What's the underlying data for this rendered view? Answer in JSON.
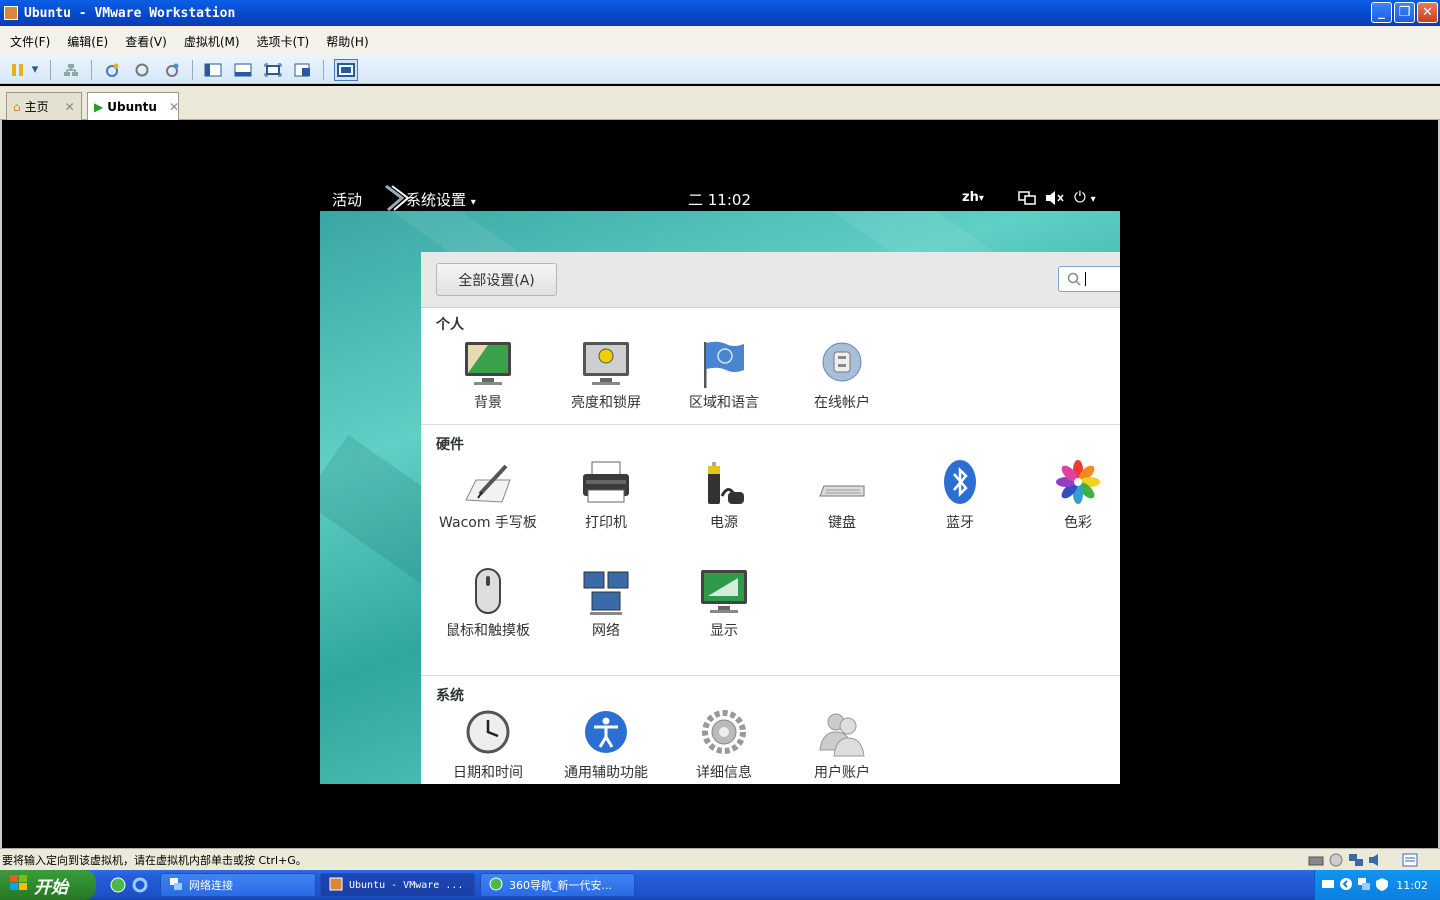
{
  "window": {
    "title": "Ubuntu - VMware Workstation",
    "min": "_",
    "max": "❐",
    "close": "✕"
  },
  "menu": [
    {
      "label": "文件(F)"
    },
    {
      "label": "编辑(E)"
    },
    {
      "label": "查看(V)"
    },
    {
      "label": "虚拟机(M)"
    },
    {
      "label": "选项卡(T)"
    },
    {
      "label": "帮助(H)"
    }
  ],
  "tabs": {
    "home": "主页",
    "ubuntu": "Ubuntu",
    "close": "✕"
  },
  "gnome": {
    "activities": "活动",
    "app_menu": "系统设置",
    "clock": "二  11:02",
    "lang": "zh",
    "arrow": "▾",
    "power": "⏻"
  },
  "settings": {
    "all_button": "全部设置(A)",
    "sections": {
      "personal": {
        "title": "个人",
        "items": [
          {
            "label": "背景",
            "icon": "background-icon"
          },
          {
            "label": "亮度和锁屏",
            "icon": "brightness-lock-icon"
          },
          {
            "label": "区域和语言",
            "icon": "region-language-icon"
          },
          {
            "label": "在线帐户",
            "icon": "online-accounts-icon"
          }
        ]
      },
      "hardware": {
        "title": "硬件",
        "items": [
          {
            "label": "Wacom 手写板",
            "icon": "wacom-tablet-icon"
          },
          {
            "label": "打印机",
            "icon": "printer-icon"
          },
          {
            "label": "电源",
            "icon": "power-icon"
          },
          {
            "label": "键盘",
            "icon": "keyboard-icon"
          },
          {
            "label": "蓝牙",
            "icon": "bluetooth-icon"
          },
          {
            "label": "色彩",
            "icon": "color-icon"
          },
          {
            "label": "鼠标和触摸板",
            "icon": "mouse-touchpad-icon"
          },
          {
            "label": "网络",
            "icon": "network-icon"
          },
          {
            "label": "显示",
            "icon": "display-icon"
          }
        ]
      },
      "system": {
        "title": "系统",
        "items": [
          {
            "label": "日期和时间",
            "icon": "date-time-icon"
          },
          {
            "label": "通用辅助功能",
            "icon": "accessibility-icon"
          },
          {
            "label": "详细信息",
            "icon": "details-icon"
          },
          {
            "label": "用户账户",
            "icon": "user-accounts-icon"
          }
        ]
      }
    }
  },
  "status": {
    "message": "要将输入定向到该虚拟机，请在虚拟机内部单击或按 Ctrl+G。"
  },
  "taskbar": {
    "start": "开始",
    "tasks": [
      {
        "label": "网络连接"
      },
      {
        "label": "Ubuntu - VMware ..."
      },
      {
        "label": "360导航_新一代安..."
      }
    ],
    "clock": "11:02"
  },
  "colors": {
    "xp_blue": "#0a5fe6",
    "start_green": "#2f8a2f",
    "ubuntu_teal": "#3aa6a3",
    "bluetooth_blue": "#2a6fd1"
  }
}
